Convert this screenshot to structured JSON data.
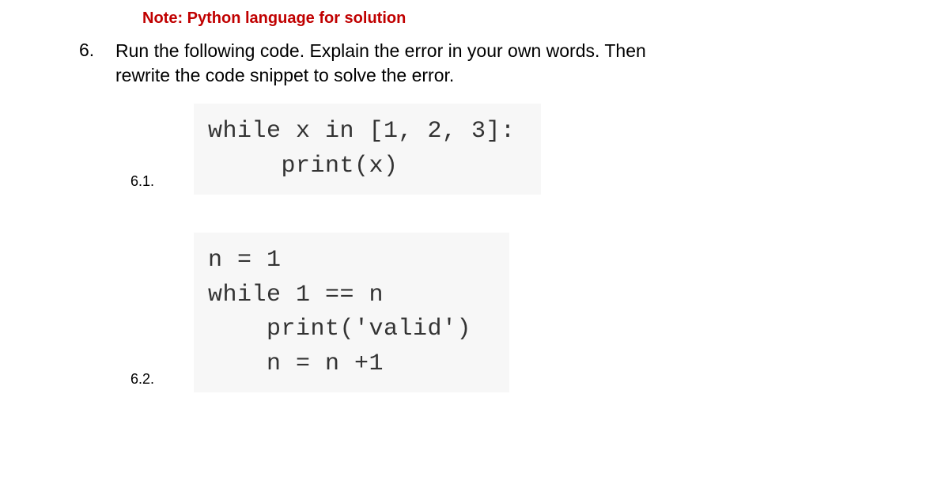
{
  "note": "Note: Python language for solution",
  "question": {
    "number": "6.",
    "text_line1": "Run the following code. Explain the error in your own words. Then",
    "text_line2": "rewrite the code snippet to solve the error."
  },
  "sub1": {
    "number": "6.1.",
    "code": "while x in [1, 2, 3]:\n     print(x)"
  },
  "sub2": {
    "number": "6.2.",
    "code": "n = 1\nwhile 1 == n\n    print('valid')\n    n = n +1"
  }
}
